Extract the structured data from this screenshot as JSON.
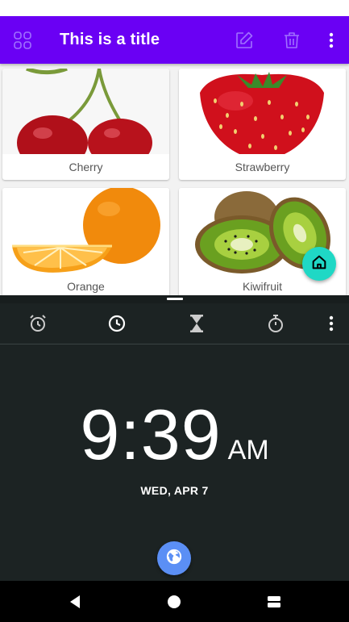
{
  "app_bar": {
    "title": "This is a title",
    "menu_icon": "grid-icon",
    "actions": [
      "edit-icon",
      "delete-icon",
      "more-vert-icon"
    ],
    "background": "#6a00f4",
    "icon_color": "#a070ff"
  },
  "fruits": [
    {
      "name": "Cherry",
      "image": "cherry-image"
    },
    {
      "name": "Strawberry",
      "image": "strawberry-image"
    },
    {
      "name": "Orange",
      "image": "orange-image"
    },
    {
      "name": "Kiwifruit",
      "image": "kiwifruit-image"
    }
  ],
  "fab": {
    "icon": "home-icon",
    "color": "#1fd8c5"
  },
  "clock": {
    "tabs": [
      "alarm-icon",
      "clock-icon",
      "timer-icon",
      "stopwatch-icon",
      "more-vert-icon"
    ],
    "time": "9:39",
    "ampm": "AM",
    "date": "WED, APR 7",
    "world_button_icon": "globe-icon",
    "background": "#1c2323"
  },
  "nav": [
    "back-icon",
    "home-circle-icon",
    "recents-icon"
  ]
}
